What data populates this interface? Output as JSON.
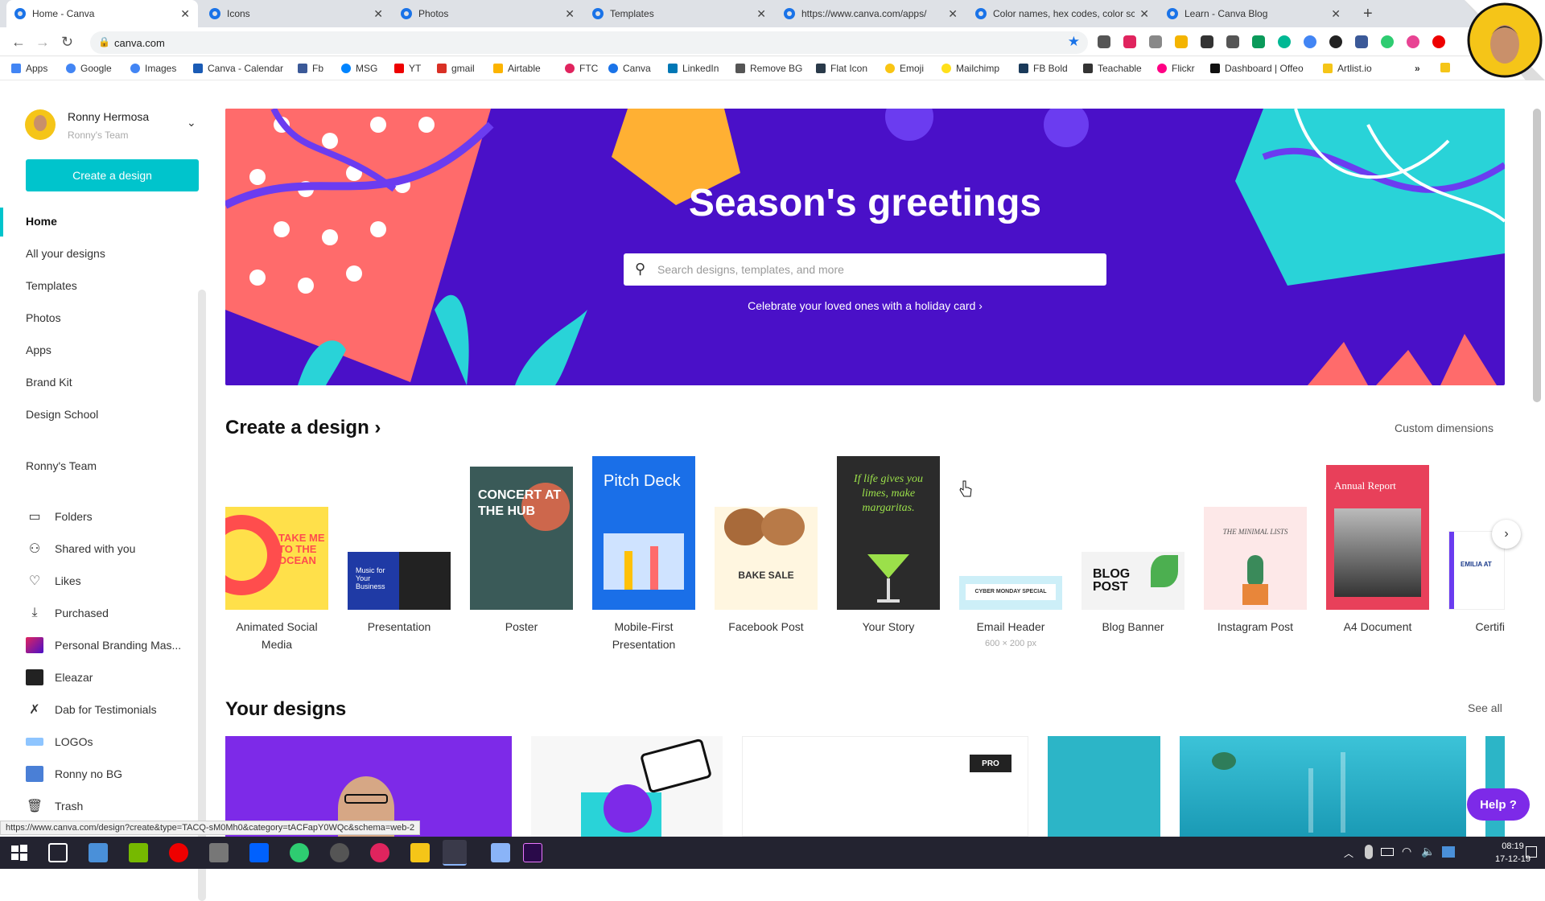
{
  "browser": {
    "tabs": [
      {
        "title": "Home - Canva",
        "active": true
      },
      {
        "title": "Icons"
      },
      {
        "title": "Photos"
      },
      {
        "title": "Templates"
      },
      {
        "title": "https://www.canva.com/apps/"
      },
      {
        "title": "Color names, hex codes, color sc"
      },
      {
        "title": "Learn - Canva Blog"
      }
    ],
    "url": "canva.com",
    "bookmarks": [
      "Apps",
      "Google",
      "Images",
      "Canva - Calendar",
      "Fb",
      "MSG",
      "YT",
      "gmail",
      "Airtable",
      "FTC",
      "Canva",
      "LinkedIn",
      "Remove BG",
      "Flat Icon",
      "Emoji",
      "Mailchimp",
      "FB Bold",
      "Teachable",
      "Flickr",
      "Dashboard | Offeo",
      "Artlist.io"
    ],
    "status_url": "https://www.canva.com/design?create&type=TACQ-sM0Mh0&category=tACFapY0WQc&schema=web-2"
  },
  "sidebar": {
    "user_name": "Ronny Hermosa",
    "user_team": "Ronny's Team",
    "create_button": "Create a design",
    "nav": [
      "Home",
      "All your designs",
      "Templates",
      "Photos",
      "Apps",
      "Brand Kit",
      "Design School"
    ],
    "team": "Ronny's Team",
    "folders": [
      {
        "label": "Folders",
        "icon": "folder-icon"
      },
      {
        "label": "Shared with you",
        "icon": "shared-users-icon"
      },
      {
        "label": "Likes",
        "icon": "heart-icon"
      },
      {
        "label": "Purchased",
        "icon": "download-icon"
      },
      {
        "label": "Personal Branding Mas...",
        "icon": "folder-thumbnail"
      },
      {
        "label": "Eleazar",
        "icon": "folder-thumbnail"
      },
      {
        "label": "Dab for Testimonials",
        "icon": "folder-thumbnail"
      },
      {
        "label": "LOGOs",
        "icon": "folder-thumbnail"
      },
      {
        "label": "Ronny no BG",
        "icon": "folder-thumbnail"
      },
      {
        "label": "Trash",
        "icon": "trash-icon"
      }
    ]
  },
  "hero": {
    "title": "Season's greetings",
    "search_placeholder": "Search designs, templates, and more",
    "holiday_link": "Celebrate your loved ones with a holiday card ›"
  },
  "create_section": {
    "title": "Create a design ›",
    "custom_dimensions": "Custom dimensions",
    "items": [
      {
        "label": "Animated Social Media",
        "thumb_text": "TAKE ME TO THE OCEAN"
      },
      {
        "label": "Presentation",
        "thumb_text": "Music for Your Business"
      },
      {
        "label": "Poster",
        "thumb_text": "CONCERT AT THE HUB"
      },
      {
        "label": "Mobile-First Presentation",
        "thumb_text": "Pitch Deck"
      },
      {
        "label": "Facebook Post",
        "thumb_text": "BAKE SALE"
      },
      {
        "label": "Your Story",
        "thumb_text": "If life gives you limes, make margaritas."
      },
      {
        "label": "Email Header",
        "sub": "600 × 200 px",
        "thumb_text": "CYBER MONDAY SPECIAL"
      },
      {
        "label": "Blog Banner",
        "thumb_text": "BLOG POST"
      },
      {
        "label": "Instagram Post",
        "thumb_text": "THE MINIMAL LISTS"
      },
      {
        "label": "A4 Document",
        "thumb_text": "Annual Report"
      },
      {
        "label": "Certifi",
        "thumb_text": "EMILIA AT"
      }
    ]
  },
  "your_designs": {
    "title": "Your designs",
    "see_all": "See all",
    "pro_badge": "PRO"
  },
  "help": "Help ?",
  "clock": {
    "time": "08:19",
    "date": "17-12-19"
  }
}
